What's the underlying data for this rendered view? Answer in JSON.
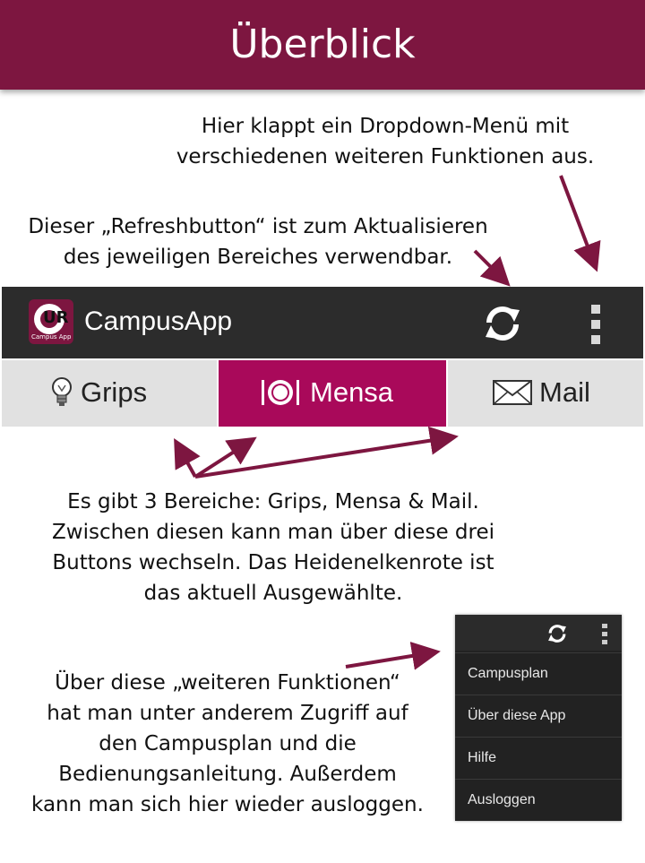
{
  "header": {
    "title": "Überblick"
  },
  "notes": {
    "dropdown": [
      "Hier klappt ein Dropdown-Menü mit",
      "verschiedenen weiteren Funktionen aus."
    ],
    "refresh": [
      "Dieser „Refreshbutton“ ist zum Aktualisieren",
      "des jeweiligen Bereiches verwendbar."
    ],
    "areas": [
      "Es gibt 3 Bereiche: Grips, Mensa & Mail.",
      "Zwischen diesen kann man über diese drei",
      "Buttons wechseln. Das Heidenelkenrote ist",
      "das aktuell Ausgewählte."
    ],
    "more": [
      "Über diese „weiteren Funktionen“",
      "hat man unter anderem Zugriff auf",
      "den Campusplan und die",
      "Bedienungsanleitung. Außerdem",
      "kann man sich hier wieder ausloggen."
    ]
  },
  "actionbar": {
    "title": "CampusApp",
    "logo_text": "UR",
    "logo_subtext": "Campus App",
    "refresh_icon": "refresh-icon",
    "overflow_icon": "more-vertical-icon"
  },
  "tabs": [
    {
      "label": "Grips",
      "icon": "lightbulb-icon",
      "selected": false
    },
    {
      "label": "Mensa",
      "icon": "plate-icon",
      "selected": true
    },
    {
      "label": "Mail",
      "icon": "envelope-icon",
      "selected": false
    }
  ],
  "menu": {
    "items": [
      "Campusplan",
      "Über diese App",
      "Hilfe",
      "Ausloggen"
    ]
  },
  "colors": {
    "header": "#7d1640",
    "selected_tab": "#a9095a",
    "actionbar": "#2c2c2c",
    "arrow": "#7d1640"
  }
}
